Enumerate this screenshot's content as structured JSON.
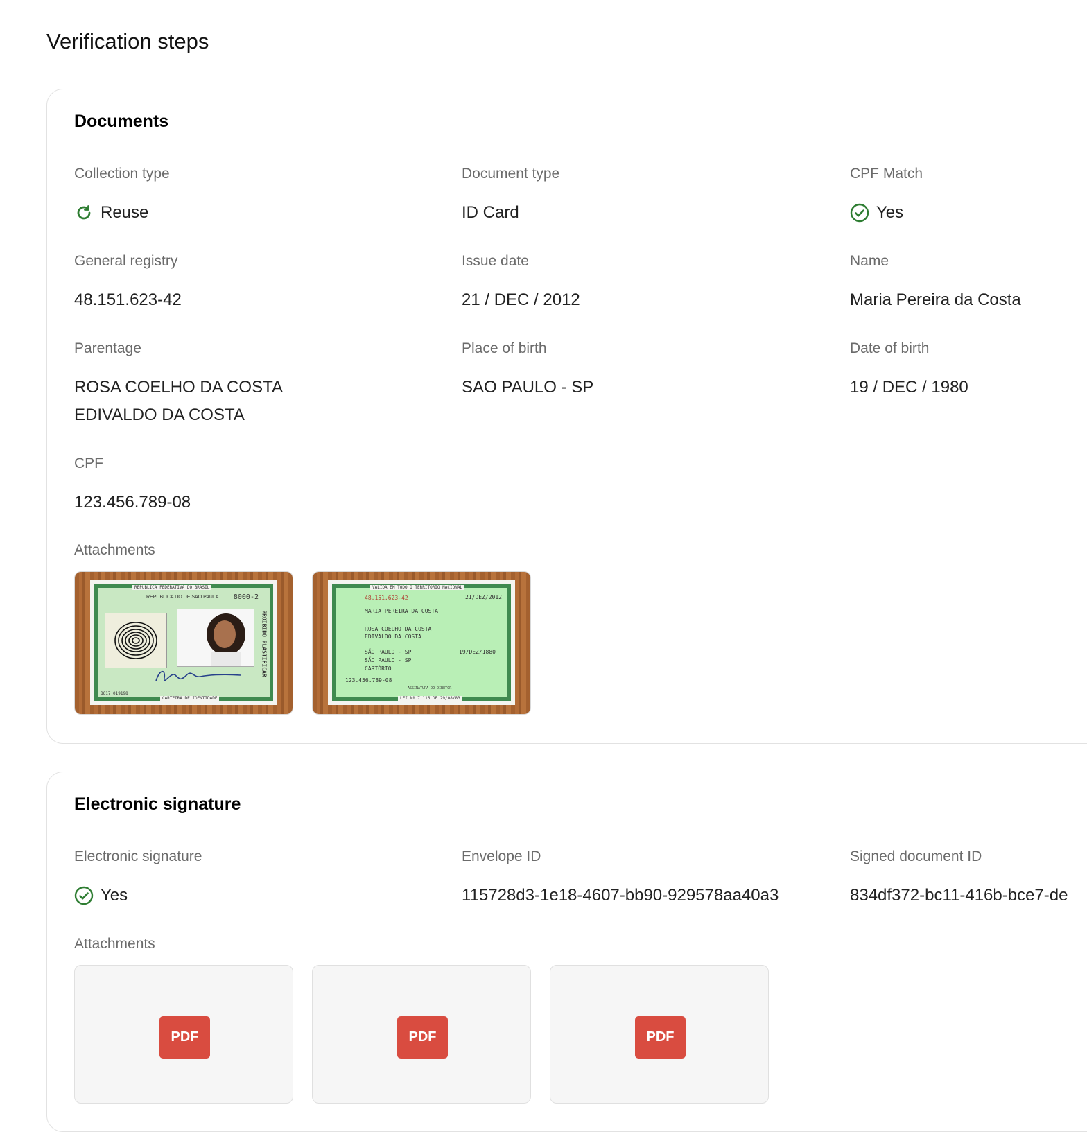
{
  "page": {
    "title": "Verification steps"
  },
  "documents": {
    "title": "Documents",
    "collection_type": {
      "label": "Collection type",
      "value": "Reuse",
      "icon": "refresh-icon"
    },
    "document_type": {
      "label": "Document type",
      "value": "ID Card"
    },
    "cpf_match": {
      "label": "CPF Match",
      "value": "Yes",
      "icon": "check-circle-icon"
    },
    "general_registry": {
      "label": "General registry",
      "value": "48.151.623-42"
    },
    "issue_date": {
      "label": "Issue date",
      "value": "21 / DEC / 2012"
    },
    "name": {
      "label": "Name",
      "value": "Maria Pereira da Costa"
    },
    "parentage": {
      "label": "Parentage",
      "values": [
        "ROSA COELHO DA COSTA",
        "EDIVALDO DA COSTA"
      ]
    },
    "place_of_birth": {
      "label": "Place of birth",
      "value": "SAO PAULO - SP"
    },
    "date_of_birth": {
      "label": "Date of birth",
      "value": "19 / DEC / 1980"
    },
    "cpf": {
      "label": "CPF",
      "value": "123.456.789-08"
    },
    "attachments_label": "Attachments",
    "id_front": {
      "header": "REPUBLICA FEDERATIVA DO BRASIL",
      "state": "REPUBLICA DO DE SAO PAULA",
      "number": "8000-2",
      "footer": "CARTEIRA DE IDENTIDADE",
      "side": "PROIBIDO PLASTIFICAR",
      "serial": "B617 019198"
    },
    "id_back": {
      "header": "VÁLIDA EM TODO O TERRITÓRIO NACIONAL",
      "registry": "48.151.623-42",
      "expedition": "21/DEZ/2012",
      "name": "MARIA PEREIRA DA COSTA",
      "mother": "ROSA COELHO DA COSTA",
      "father": "EDIVALDO DA COSTA",
      "birthplace1": "SÃO PAULO - SP",
      "birthplace2": "SÃO PAULO - SP",
      "registry_office": "CARTÓRIO",
      "birth_date": "19/DEZ/1880",
      "cpf": "123.456.789-08",
      "footer": "LEI Nº 7.116 DE 29/08/83",
      "signature_label": "ASSINATURA DO DIRETOR"
    }
  },
  "esignature": {
    "title": "Electronic signature",
    "signature": {
      "label": "Electronic signature",
      "value": "Yes",
      "icon": "check-circle-icon"
    },
    "envelope_id": {
      "label": "Envelope ID",
      "value": "115728d3-1e18-4607-bb90-929578aa40a3"
    },
    "signed_document_id": {
      "label": "Signed document ID",
      "value": "834df372-bc11-416b-bce7-de"
    },
    "attachments_label": "Attachments",
    "pdf_label": "PDF"
  },
  "colors": {
    "success": "#2e7d32",
    "pdf": "#d94c40",
    "border": "#e2e2e2"
  }
}
